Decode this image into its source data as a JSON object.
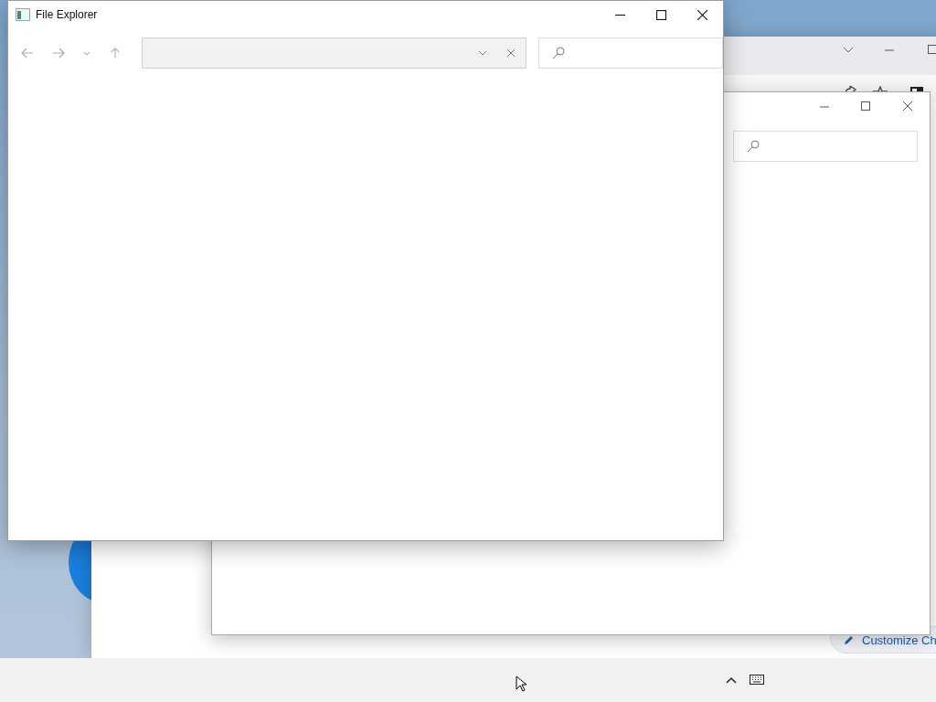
{
  "explorer": {
    "title": "File Explorer"
  },
  "browser": {
    "customize_button": {
      "label": "Customize Ch"
    }
  }
}
